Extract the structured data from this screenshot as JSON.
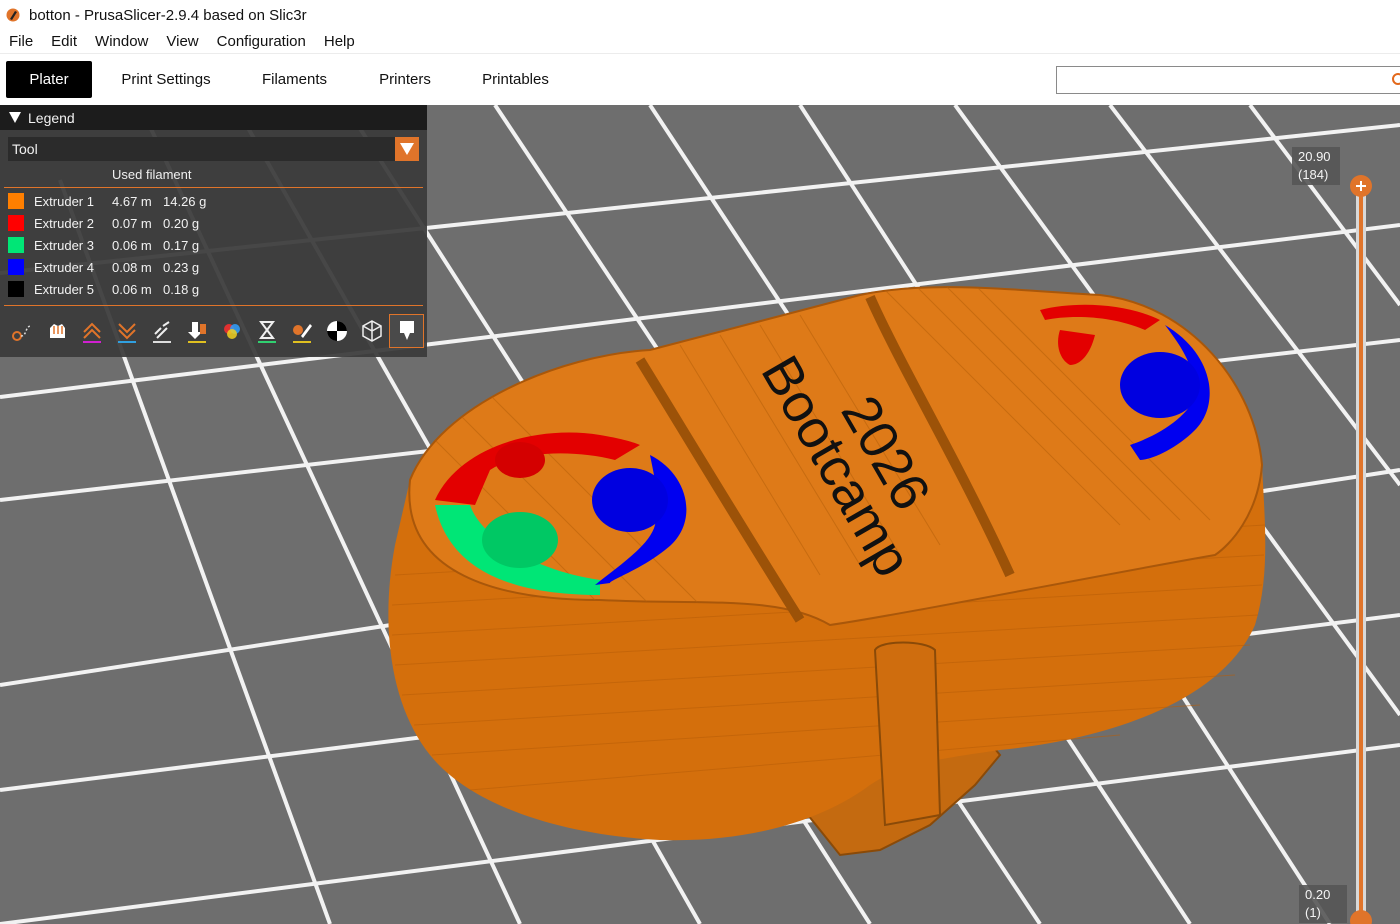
{
  "window": {
    "title": "botton - PrusaSlicer-2.9.4 based on Slic3r",
    "app_icon": "prusaslicer-icon"
  },
  "menu": {
    "items": [
      "File",
      "Edit",
      "Window",
      "View",
      "Configuration",
      "Help"
    ]
  },
  "tabs": {
    "items": [
      {
        "label": "Plater",
        "active": true
      },
      {
        "label": "Print Settings",
        "active": false
      },
      {
        "label": "Filaments",
        "active": false
      },
      {
        "label": "Printers",
        "active": false
      },
      {
        "label": "Printables",
        "active": false
      }
    ]
  },
  "search": {
    "value": "",
    "placeholder": "",
    "icon": "search-icon"
  },
  "legend": {
    "title": "Legend",
    "view_type": "Tool",
    "column_header": "Used filament",
    "extruders": [
      {
        "name": "Extruder 1",
        "length": "4.67 m",
        "weight": "14.26 g",
        "color": "#ff7f00"
      },
      {
        "name": "Extruder 2",
        "length": "0.07 m",
        "weight": "0.20 g",
        "color": "#ff0000"
      },
      {
        "name": "Extruder 3",
        "length": "0.06 m",
        "weight": "0.17 g",
        "color": "#00e676"
      },
      {
        "name": "Extruder 4",
        "length": "0.08 m",
        "weight": "0.23 g",
        "color": "#0000ff"
      },
      {
        "name": "Extruder 5",
        "length": "0.06 m",
        "weight": "0.18 g",
        "color": "#000000"
      }
    ],
    "toolbar_icons": [
      "travel-icon",
      "wipe-icon",
      "retractions-icon",
      "deretractions-icon",
      "seams-icon",
      "tool-changes-icon",
      "color-changes-icon",
      "pause-prints-icon",
      "custom-gcodes-icon",
      "center-of-gravity-icon",
      "shells-icon",
      "tool-marker-icon"
    ]
  },
  "layer_slider": {
    "top_height": "20.90",
    "top_layer": "(184)",
    "bottom_height": "0.20",
    "bottom_layer": "(1)"
  },
  "model": {
    "embossed_text_line1": "Bootcamp",
    "embossed_text_line2": "2026"
  },
  "colors": {
    "accent": "#e0742a",
    "viewport_bg": "#6e6e6e",
    "model": "#d8740f"
  }
}
